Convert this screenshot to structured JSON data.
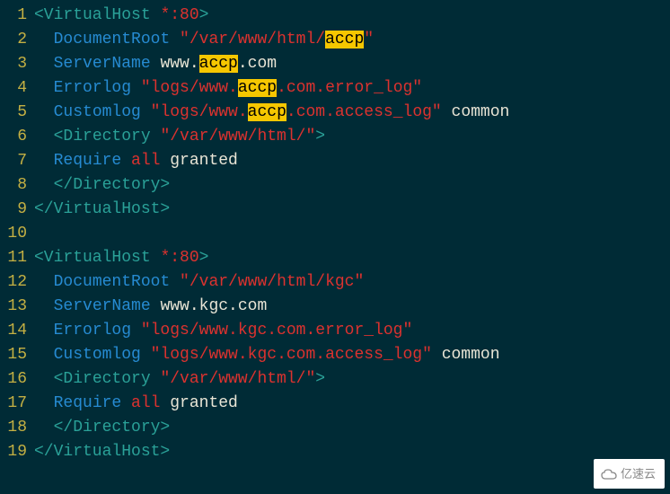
{
  "watermark": "亿速云",
  "lines": [
    {
      "n": 1,
      "segs": [
        {
          "cls": "c-bracket",
          "t": "<VirtualHost "
        },
        {
          "cls": "c-red",
          "t": "*:80"
        },
        {
          "cls": "c-bracket",
          "t": ">"
        }
      ]
    },
    {
      "n": 2,
      "segs": [
        {
          "cls": "",
          "t": "  "
        },
        {
          "cls": "c-attr",
          "t": "DocumentRoot "
        },
        {
          "cls": "c-red",
          "t": "\"/var/www/html/"
        },
        {
          "cls": "hl",
          "t": "accp"
        },
        {
          "cls": "c-red",
          "t": "\""
        }
      ]
    },
    {
      "n": 3,
      "segs": [
        {
          "cls": "",
          "t": "  "
        },
        {
          "cls": "c-attr",
          "t": "ServerName "
        },
        {
          "cls": "c-white",
          "t": "www."
        },
        {
          "cls": "hl",
          "t": "accp"
        },
        {
          "cls": "c-white",
          "t": ".com"
        }
      ]
    },
    {
      "n": 4,
      "segs": [
        {
          "cls": "",
          "t": "  "
        },
        {
          "cls": "c-attr",
          "t": "Errorlog "
        },
        {
          "cls": "c-red",
          "t": "\"logs/www."
        },
        {
          "cls": "hl",
          "t": "accp"
        },
        {
          "cls": "c-red",
          "t": ".com.error_log\""
        }
      ]
    },
    {
      "n": 5,
      "segs": [
        {
          "cls": "",
          "t": "  "
        },
        {
          "cls": "c-attr",
          "t": "Customlog "
        },
        {
          "cls": "c-red",
          "t": "\"logs/www."
        },
        {
          "cls": "hl",
          "t": "accp"
        },
        {
          "cls": "c-red",
          "t": ".com.access_log\" "
        },
        {
          "cls": "c-white",
          "t": "common"
        }
      ]
    },
    {
      "n": 6,
      "segs": [
        {
          "cls": "",
          "t": "  "
        },
        {
          "cls": "c-bracket",
          "t": "<Directory "
        },
        {
          "cls": "c-red",
          "t": "\"/var/www/html/\""
        },
        {
          "cls": "c-bracket",
          "t": ">"
        }
      ]
    },
    {
      "n": 7,
      "segs": [
        {
          "cls": "",
          "t": "  "
        },
        {
          "cls": "c-attr",
          "t": "Require "
        },
        {
          "cls": "c-red",
          "t": "all "
        },
        {
          "cls": "c-white",
          "t": "granted"
        }
      ]
    },
    {
      "n": 8,
      "segs": [
        {
          "cls": "",
          "t": "  "
        },
        {
          "cls": "c-bracket",
          "t": "</Directory>"
        }
      ]
    },
    {
      "n": 9,
      "segs": [
        {
          "cls": "c-bracket",
          "t": "</VirtualHost>"
        }
      ]
    },
    {
      "n": 10,
      "segs": [
        {
          "cls": "",
          "t": ""
        }
      ]
    },
    {
      "n": 11,
      "segs": [
        {
          "cls": "c-bracket",
          "t": "<VirtualHost "
        },
        {
          "cls": "c-red",
          "t": "*:80"
        },
        {
          "cls": "c-bracket",
          "t": ">"
        }
      ]
    },
    {
      "n": 12,
      "segs": [
        {
          "cls": "",
          "t": "  "
        },
        {
          "cls": "c-attr",
          "t": "DocumentRoot "
        },
        {
          "cls": "c-red",
          "t": "\"/var/www/html/kgc\""
        }
      ]
    },
    {
      "n": 13,
      "segs": [
        {
          "cls": "",
          "t": "  "
        },
        {
          "cls": "c-attr",
          "t": "ServerName "
        },
        {
          "cls": "c-white",
          "t": "www.kgc.com"
        }
      ]
    },
    {
      "n": 14,
      "segs": [
        {
          "cls": "",
          "t": "  "
        },
        {
          "cls": "c-attr",
          "t": "Errorlog "
        },
        {
          "cls": "c-red",
          "t": "\"logs/www.kgc.com.error_log\""
        }
      ]
    },
    {
      "n": 15,
      "segs": [
        {
          "cls": "",
          "t": "  "
        },
        {
          "cls": "c-attr",
          "t": "Customlog "
        },
        {
          "cls": "c-red",
          "t": "\"logs/www.kgc.com.access_log\" "
        },
        {
          "cls": "c-white",
          "t": "common"
        }
      ]
    },
    {
      "n": 16,
      "segs": [
        {
          "cls": "",
          "t": "  "
        },
        {
          "cls": "c-bracket",
          "t": "<Directory "
        },
        {
          "cls": "c-red",
          "t": "\"/var/www/html/\""
        },
        {
          "cls": "c-bracket",
          "t": ">"
        }
      ]
    },
    {
      "n": 17,
      "segs": [
        {
          "cls": "",
          "t": "  "
        },
        {
          "cls": "c-attr",
          "t": "Require "
        },
        {
          "cls": "c-red",
          "t": "all "
        },
        {
          "cls": "c-white",
          "t": "granted"
        }
      ]
    },
    {
      "n": 18,
      "segs": [
        {
          "cls": "",
          "t": "  "
        },
        {
          "cls": "c-bracket",
          "t": "</Directory>"
        }
      ]
    },
    {
      "n": 19,
      "segs": [
        {
          "cls": "c-bracket",
          "t": "</VirtualHost>"
        }
      ]
    }
  ]
}
